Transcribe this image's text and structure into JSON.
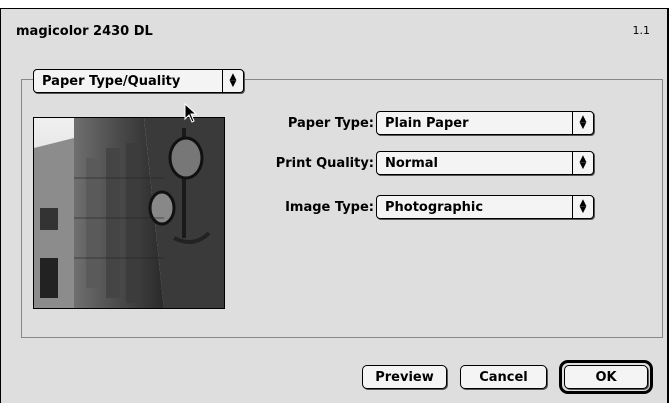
{
  "dialog": {
    "title": "magicolor 2430 DL",
    "version": "1.1"
  },
  "panel_selector": {
    "selected": "Paper Type/Quality"
  },
  "fields": [
    {
      "label": "Paper Type:",
      "value": "Plain Paper"
    },
    {
      "label": "Print Quality:",
      "value": "Normal"
    },
    {
      "label": "Image Type:",
      "value": "Photographic"
    }
  ],
  "buttons": {
    "preview": "Preview",
    "cancel": "Cancel",
    "ok": "OK"
  },
  "icons": {
    "popup_arrow": "up-down-arrows-icon",
    "cursor": "mouse-pointer-icon"
  }
}
